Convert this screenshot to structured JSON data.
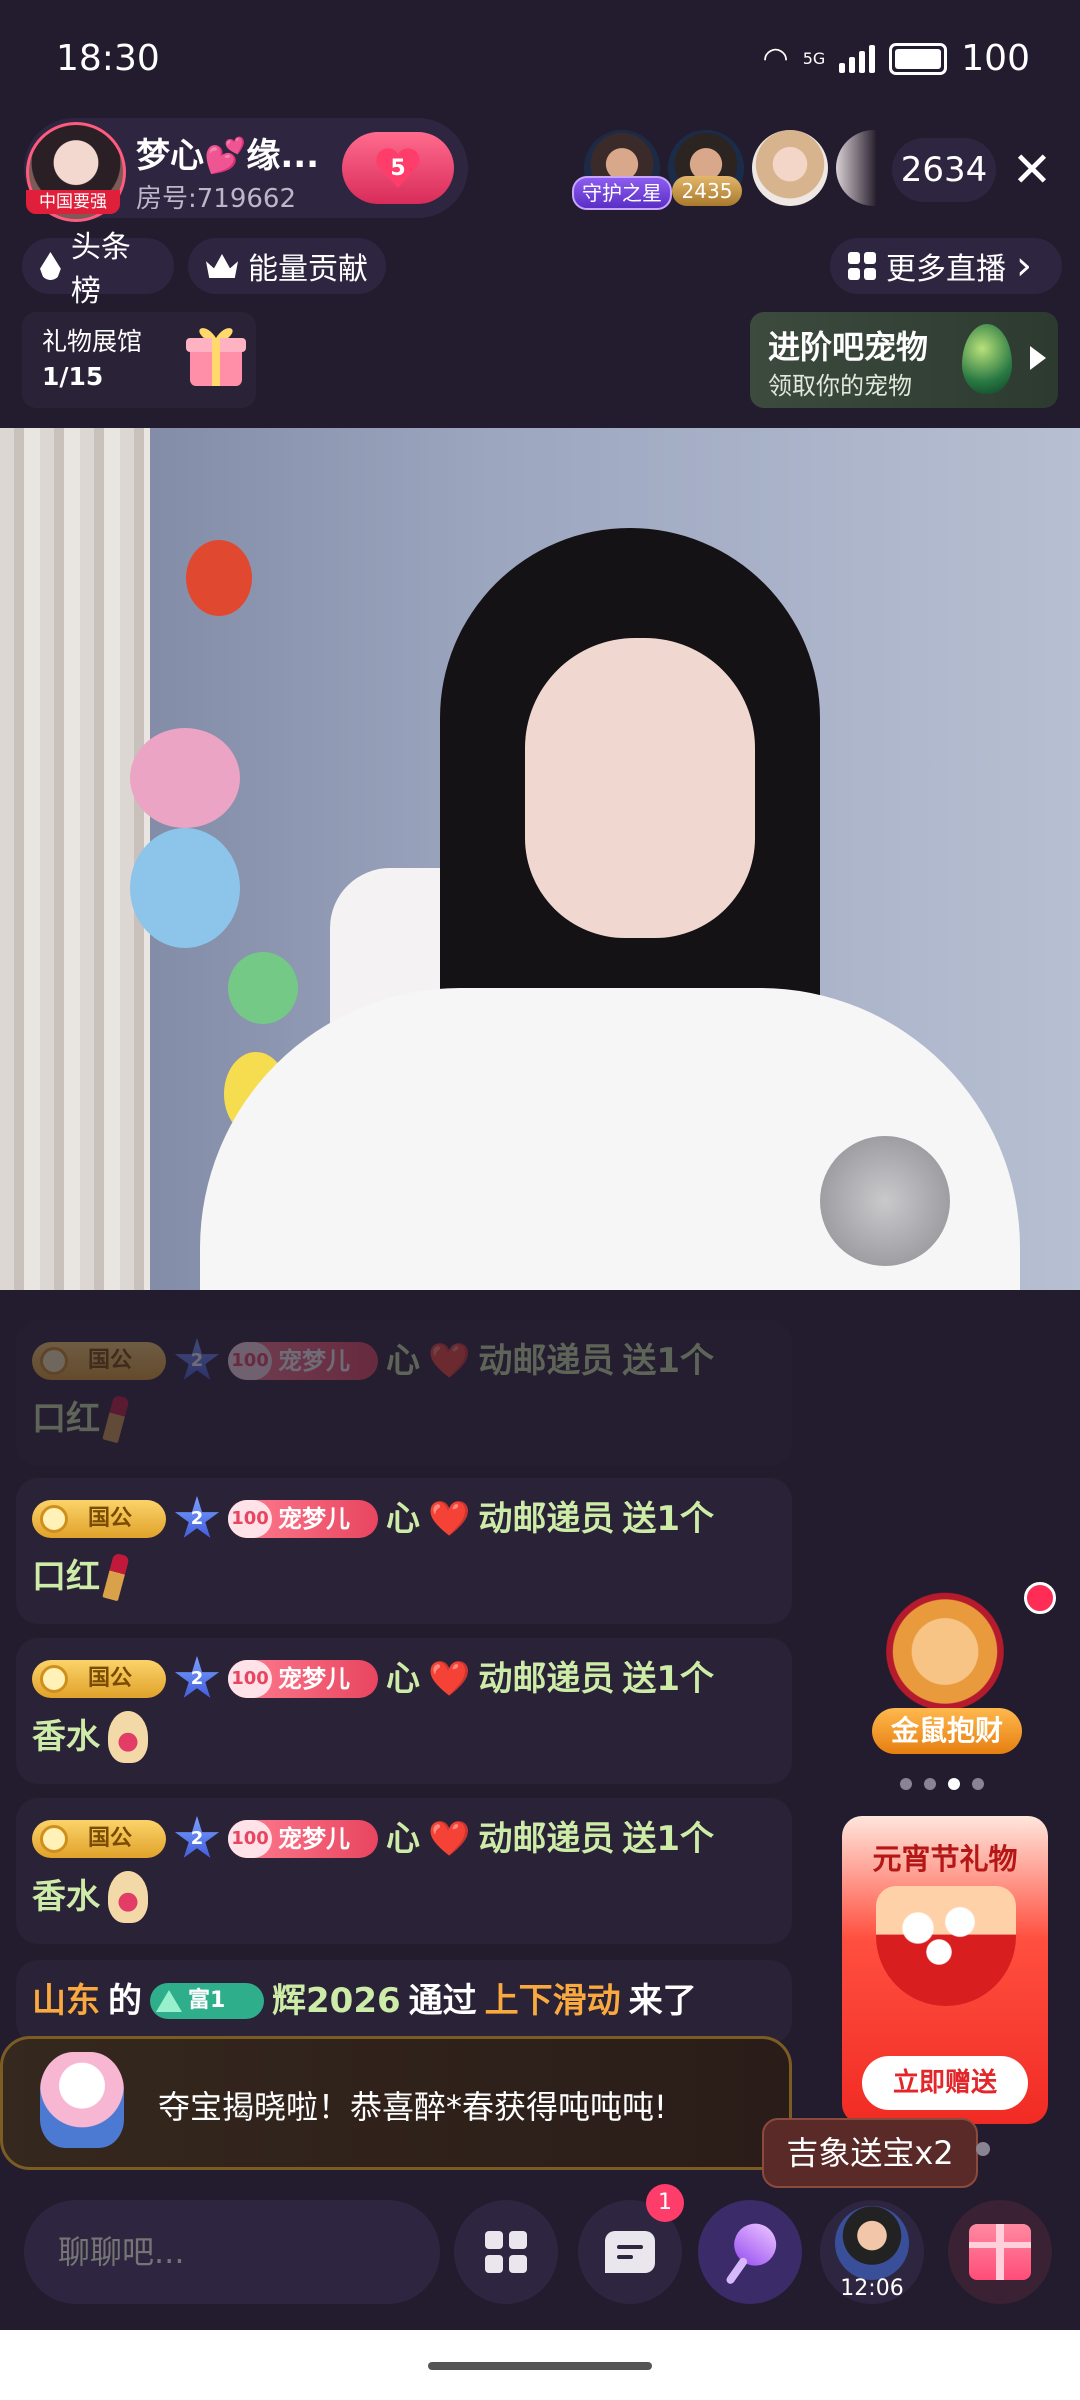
{
  "status_bar": {
    "time": "18:30",
    "network": "5G",
    "battery": "100"
  },
  "host": {
    "name": "梦心💕缘...",
    "room_label": "房号:719662",
    "avatar_tag": "中国要强",
    "follow_level": "5"
  },
  "viewers": {
    "guard_tag": "守护之星",
    "score_tag": "2435",
    "count": "2634",
    "close_label": "✕"
  },
  "nav_pills": {
    "toplist": "头条榜",
    "energy": "能量贡献",
    "more_live": "更多直播",
    "more_arrow": "›"
  },
  "gift_hall": {
    "title": "礼物展馆",
    "count": "1/15"
  },
  "pet_banner": {
    "title": "进阶吧宠物",
    "subtitle": "领取你的宠物"
  },
  "chat": {
    "badge_gong": "国公",
    "badge_star": "2",
    "badge_love_level": "100",
    "badge_love_name": "宠梦儿",
    "sender_pre": "心",
    "sender_heart": "❤️",
    "sender_post": "动邮递员",
    "action": "送1个",
    "messages": [
      {
        "item": "口红",
        "icon": "lipstick-icon"
      },
      {
        "item": "口红",
        "icon": "lipstick-icon"
      },
      {
        "item": "香水",
        "icon": "perfume-icon"
      },
      {
        "item": "香水",
        "icon": "perfume-icon"
      }
    ],
    "entry": {
      "region": "山东",
      "de": "的",
      "rich_badge": "富1",
      "user": "辉2026",
      "via": "通过",
      "method": "上下滑动",
      "came": "来了"
    }
  },
  "treasure": {
    "text": "夺宝揭晓啦！恭喜醉*春获得吨吨吨!"
  },
  "promos": {
    "rat_label": "金鼠抱财",
    "lantern_title": "元宵节礼物",
    "lantern_button": "立即赠送",
    "lucky_tag": "吉象送宝x2"
  },
  "bottom_bar": {
    "chat_placeholder": "聊聊吧...",
    "message_badge": "1",
    "guard_time": "12:06"
  },
  "colors": {
    "background": "#221c2e",
    "accent_pink": "#ff3d6a",
    "gold": "#f9a93d",
    "green_text": "#cdeca8"
  }
}
